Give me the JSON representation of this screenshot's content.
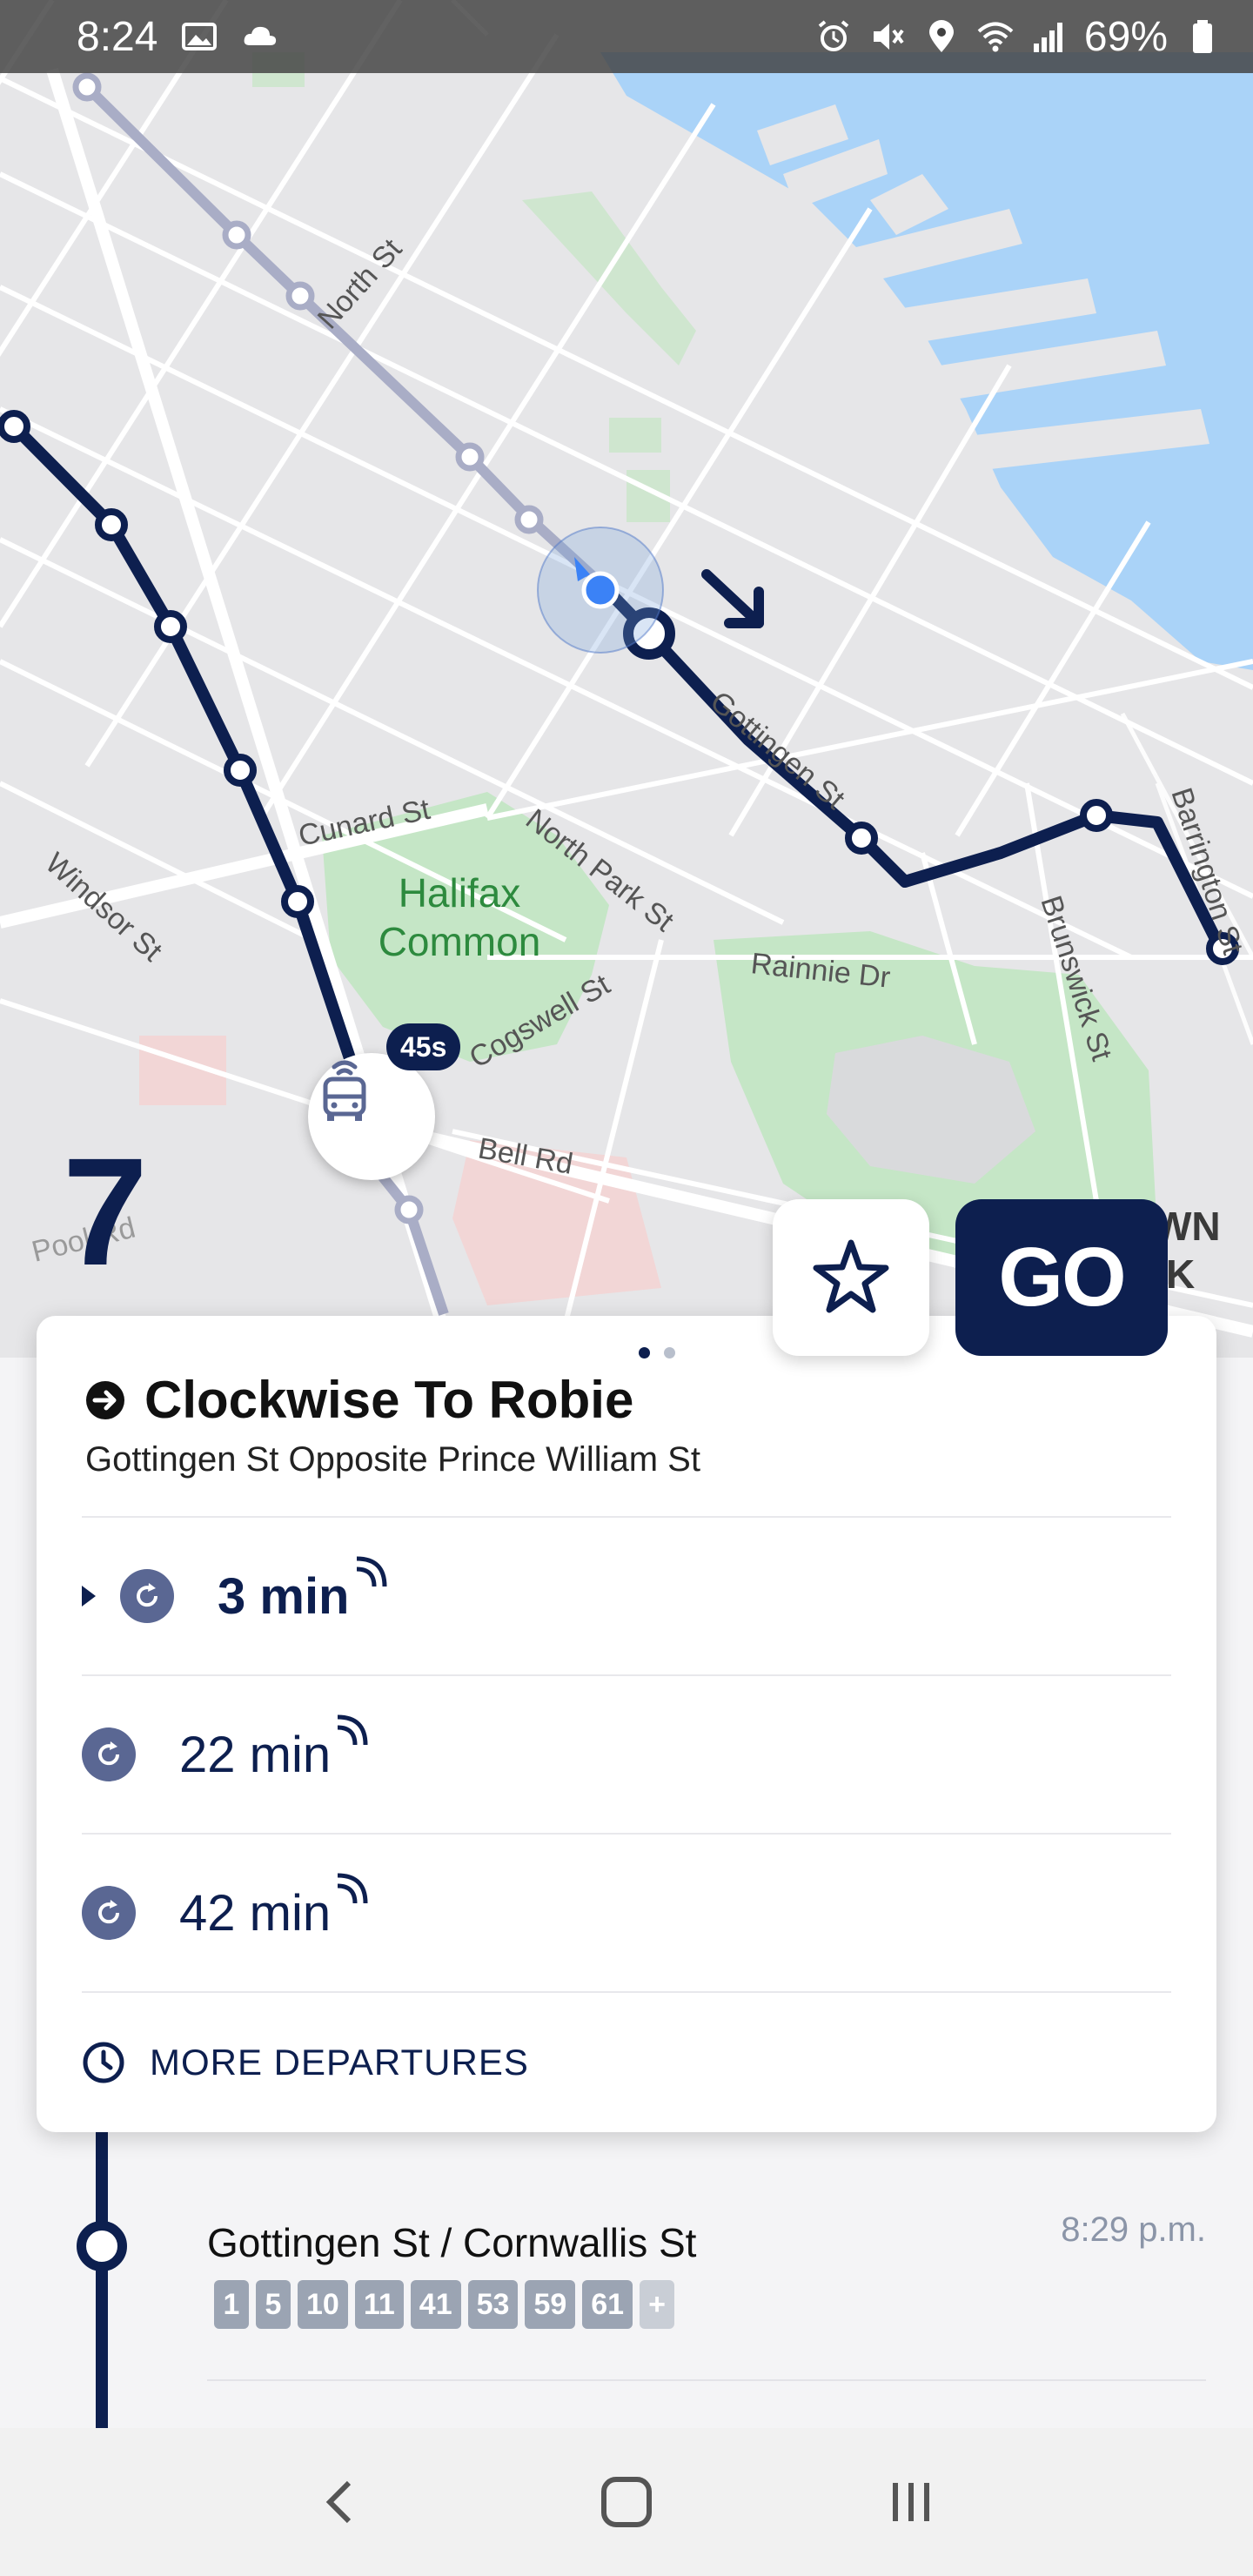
{
  "status_bar": {
    "time": "8:24",
    "battery": "69%",
    "left_icons": [
      "image-icon",
      "cloud-icon"
    ],
    "right_icons": [
      "alarm-icon",
      "mute-icon",
      "location-icon",
      "wifi-icon",
      "signal-icon",
      "battery-icon"
    ]
  },
  "map": {
    "labels": {
      "north_st": "North St",
      "cunard_st": "Cunard St",
      "north_park_st": "North Park St",
      "windsor_st": "Windsor St",
      "halifax_common_1": "Halifax",
      "halifax_common_2": "Common",
      "cogswell_st": "Cogswell St",
      "rainnie_dr": "Rainnie Dr",
      "gottingen_st": "Gottingen St",
      "brunswick_st": "Brunswick St",
      "barrington_st": "Barrington St",
      "bell_rd": "Bell Rd",
      "pool_rd": "Pool Rd",
      "downtown_1": "WN",
      "downtown_2": "K"
    },
    "route_number": "7",
    "bus_eta_badge": "45s",
    "go_label": "GO",
    "colors": {
      "route": "#0d1f4f",
      "water": "#aad3f8",
      "park": "#c5e6c6",
      "other_route": "#a9adc6"
    }
  },
  "card": {
    "page_indicator": {
      "pages": 2,
      "current": 1
    },
    "headsign": "Clockwise To Robie",
    "stop_name": "Gottingen St Opposite Prince William St",
    "departures": [
      {
        "time": "3 min",
        "selected": true
      },
      {
        "time": "22 min",
        "selected": false
      },
      {
        "time": "42 min",
        "selected": false
      }
    ],
    "more_departures": "MORE DEPARTURES"
  },
  "next_stop": {
    "name": "Gottingen St / Cornwallis St",
    "time": "8:29 p.m.",
    "routes": [
      "1",
      "5",
      "10",
      "11",
      "41",
      "53",
      "59",
      "61",
      "+"
    ]
  },
  "nav_bar": {
    "buttons": [
      "back",
      "home",
      "recents"
    ]
  }
}
